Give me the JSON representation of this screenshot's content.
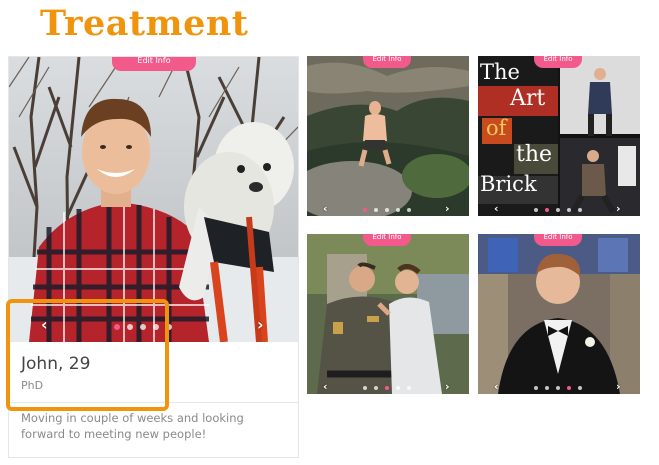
{
  "heading": "Treatment",
  "colors": {
    "accent": "#f0940e",
    "pink": "#f25a8b",
    "text_muted": "#8a8a8a"
  },
  "main_card": {
    "edit_label": "Edit Info",
    "name_age": "John, 29",
    "education": "PhD",
    "bio": "Moving in couple of weeks and looking forward to meeting new people!",
    "photo_count": 5,
    "active_photo": 1
  },
  "grid_cards": [
    {
      "edit_label": "Edit Info",
      "photo_count": 5,
      "active_photo": 1,
      "photo": "man-in-pond"
    },
    {
      "edit_label": "Edit Info",
      "photo_count": 5,
      "active_photo": 2,
      "photo": "art-of-the-brick-exhibit",
      "sign_words": [
        "The",
        "Art",
        "of",
        "the",
        "Brick"
      ]
    },
    {
      "edit_label": "Edit Info",
      "photo_count": 5,
      "active_photo": 3,
      "photo": "men-with-officer"
    },
    {
      "edit_label": "Edit Info",
      "photo_count": 5,
      "active_photo": 4,
      "photo": "man-in-tuxedo"
    }
  ],
  "icons": {
    "prev": "‹",
    "next": "›"
  }
}
